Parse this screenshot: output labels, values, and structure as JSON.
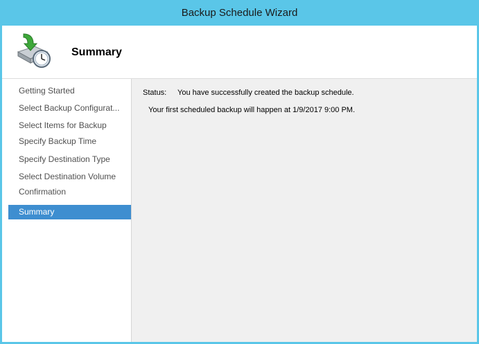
{
  "window": {
    "title": "Backup Schedule Wizard",
    "accent_color": "#5ac6e8"
  },
  "header": {
    "title": "Summary",
    "icon": "backup-schedule-icon"
  },
  "nav": {
    "items": [
      {
        "label": "Getting Started",
        "active": false
      },
      {
        "label": "Select Backup Configurat...",
        "active": false
      },
      {
        "label": "Select Items for Backup",
        "active": false
      },
      {
        "label": "Specify Backup Time",
        "active": false
      },
      {
        "label": "Specify Destination Type",
        "active": false
      },
      {
        "label": "Select Destination Volume",
        "active": false
      },
      {
        "label": "Confirmation",
        "active": false
      },
      {
        "label": "Summary",
        "active": true
      }
    ],
    "active_color": "#3e8ed0"
  },
  "content": {
    "status_label": "Status:",
    "status_text": "You have successfully created the backup schedule.",
    "next_backup_text": "Your first scheduled backup will happen at 1/9/2017 9:00 PM."
  }
}
